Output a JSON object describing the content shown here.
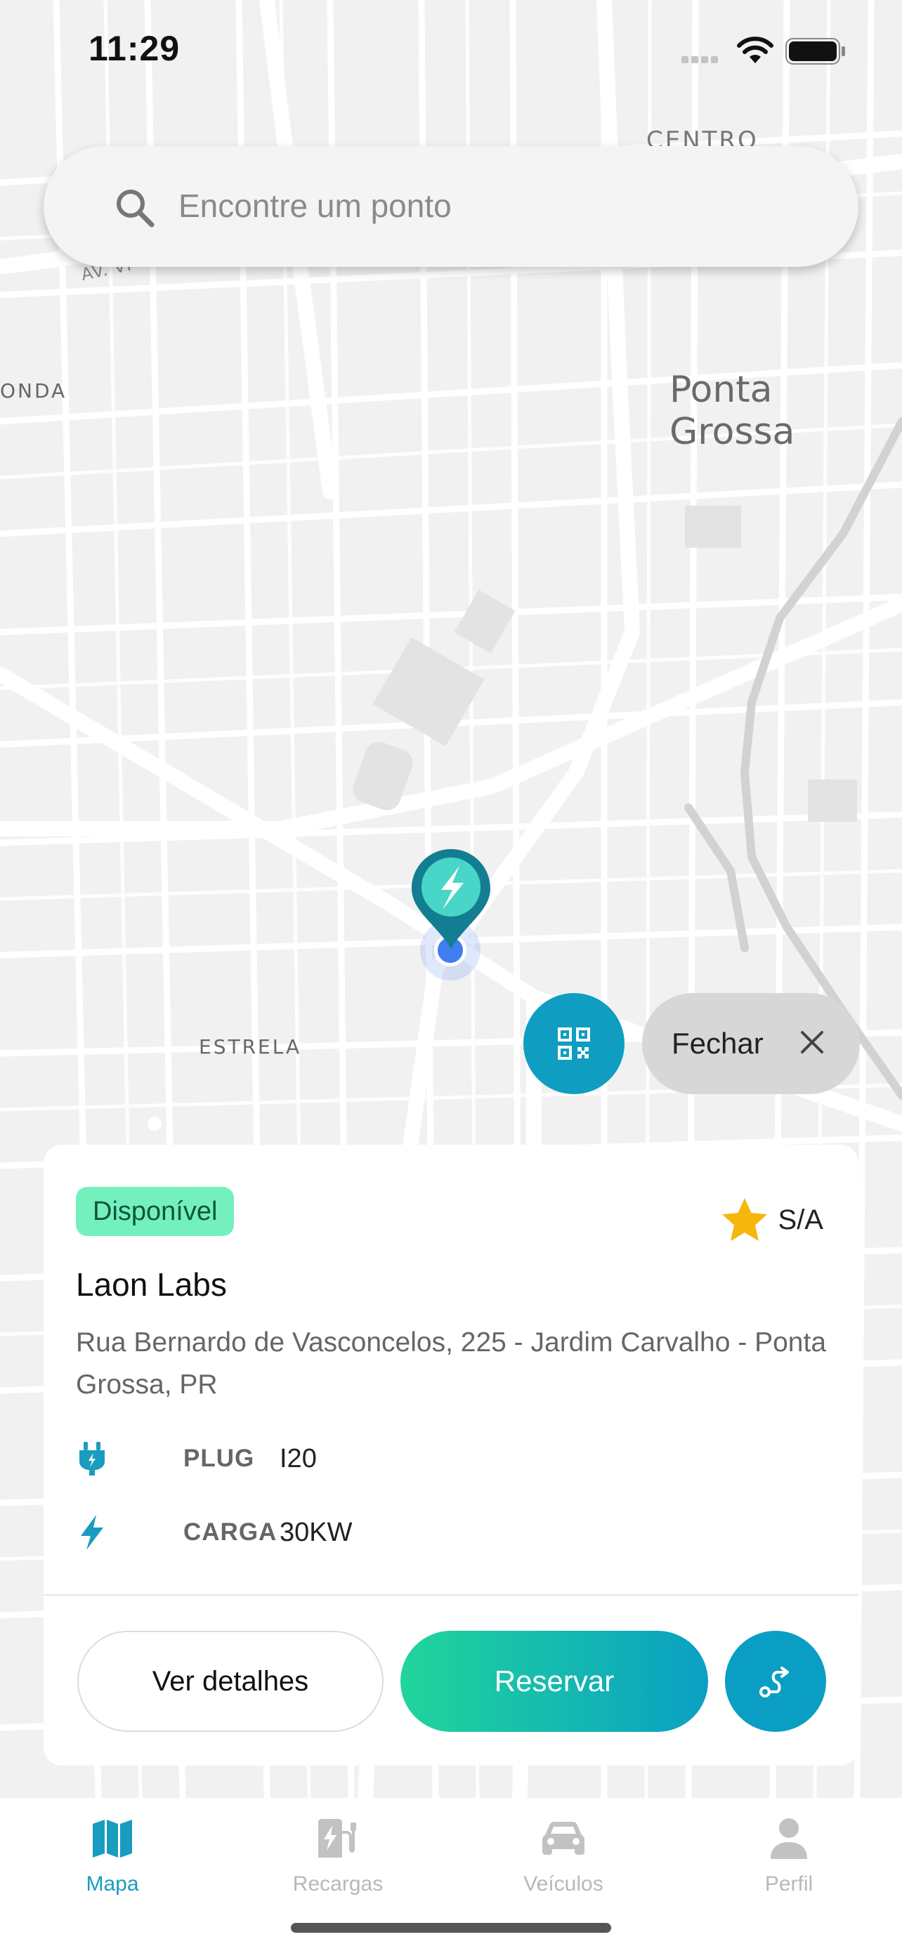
{
  "status_bar": {
    "time": "11:29"
  },
  "search": {
    "placeholder": "Encontre um ponto"
  },
  "map": {
    "labels": {
      "centro": "CENTRO",
      "onda": "ONDA",
      "estrela": "ESTRELA",
      "city": "Ponta Grossa",
      "avenue": "AV. VI"
    }
  },
  "floating": {
    "close_label": "Fechar"
  },
  "station": {
    "status": "Disponível",
    "rating": "S/A",
    "name": "Laon Labs",
    "address": "Rua Bernardo de Vasconcelos, 225 - Jardim Carvalho - Ponta Grossa, PR",
    "plug_label": "PLUG",
    "plug_value": "I20",
    "charge_label": "CARGA",
    "charge_value": "30KW"
  },
  "actions": {
    "details_label": "Ver detalhes",
    "reserve_label": "Reservar"
  },
  "tabs": [
    {
      "label": "Mapa",
      "icon": "map-icon",
      "active": true
    },
    {
      "label": "Recargas",
      "icon": "charging-station-icon",
      "active": false
    },
    {
      "label": "Veículos",
      "icon": "car-icon",
      "active": false
    },
    {
      "label": "Perfil",
      "icon": "person-icon",
      "active": false
    }
  ],
  "colors": {
    "accent": "#0f9ec1",
    "badge_bg": "#74f0bf",
    "gradient_start": "#21d59a",
    "gradient_end": "#0aa0c4",
    "star": "#f6b60c"
  }
}
